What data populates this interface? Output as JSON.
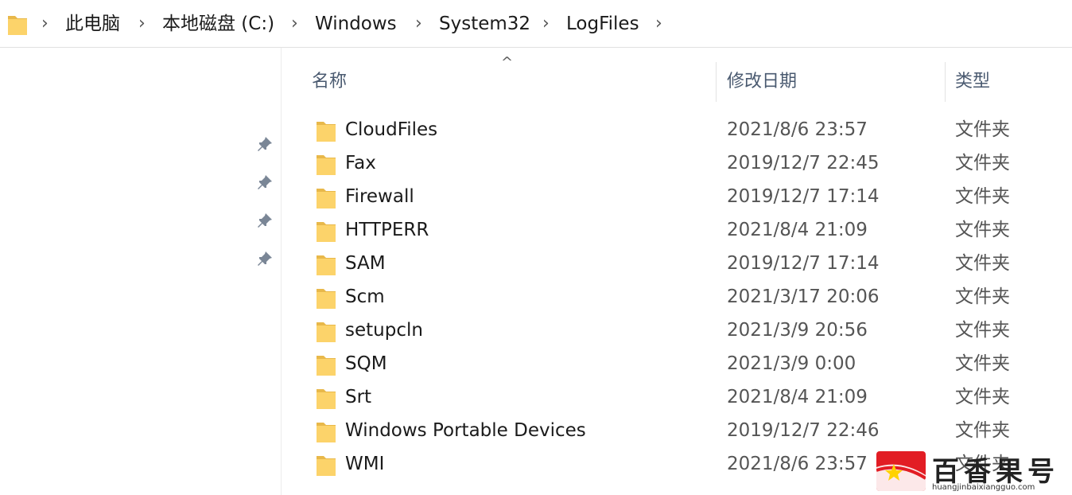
{
  "breadcrumb": {
    "items": [
      "此电脑",
      "本地磁盘 (C:)",
      "Windows",
      "System32",
      "LogFiles"
    ],
    "separator": "›"
  },
  "columns": {
    "name": "名称",
    "date": "修改日期",
    "type": "类型",
    "sort_indicator": "^"
  },
  "rows": [
    {
      "name": "CloudFiles",
      "date": "2021/8/6 23:57",
      "type": "文件夹"
    },
    {
      "name": "Fax",
      "date": "2019/12/7 22:45",
      "type": "文件夹"
    },
    {
      "name": "Firewall",
      "date": "2019/12/7 17:14",
      "type": "文件夹"
    },
    {
      "name": "HTTPERR",
      "date": "2021/8/4 21:09",
      "type": "文件夹"
    },
    {
      "name": "SAM",
      "date": "2019/12/7 17:14",
      "type": "文件夹"
    },
    {
      "name": "Scm",
      "date": "2021/3/17 20:06",
      "type": "文件夹"
    },
    {
      "name": "setupcln",
      "date": "2021/3/9 20:56",
      "type": "文件夹"
    },
    {
      "name": "SQM",
      "date": "2021/3/9 0:00",
      "type": "文件夹"
    },
    {
      "name": "Srt",
      "date": "2021/8/4 21:09",
      "type": "文件夹"
    },
    {
      "name": "Windows Portable Devices",
      "date": "2019/12/7 22:46",
      "type": "文件夹"
    },
    {
      "name": "WMI",
      "date": "2021/8/6 23:57",
      "type": "文件夹"
    }
  ],
  "watermark": {
    "title": "百香果号",
    "url": "huangjinbaixiangguo.com"
  },
  "colors": {
    "folder_fill": "#FCD36A",
    "folder_tab": "#E8B84A",
    "header_text": "#4A5A70",
    "watermark_red": "#E21D24"
  },
  "icons": {
    "address_folder": "folder-icon",
    "pin": "pin-icon",
    "row_folder": "folder-icon",
    "watermark_logo": "star-logo-icon"
  }
}
